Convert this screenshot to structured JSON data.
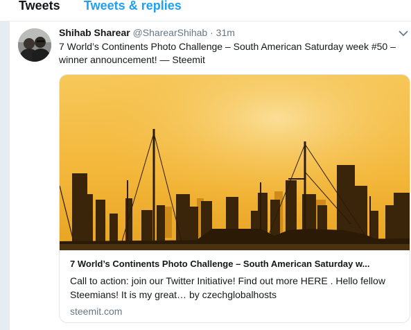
{
  "tabs": [
    {
      "label": "Tweets"
    },
    {
      "label": "Tweets & replies"
    }
  ],
  "tweet": {
    "author_name": "Shihab Sharear",
    "author_handle": "@SharearShihab",
    "separator": "·",
    "time": "31m",
    "text": "7 World’s Continents Photo Challenge – South American Saturday week #50 – winner announcement! — Steemit",
    "card": {
      "title": "7 World’s Continents Photo Challenge – South American Saturday w...",
      "description": "Call to action: join our Twitter Initiative! Find out more HERE . Hello fellow Steemians! It is my great… by czechglobalhosts",
      "domain": "steemit.com"
    }
  },
  "icons": {
    "avatar": "profile-photo",
    "menu": "chevron-down-icon"
  },
  "colors": {
    "accent": "#1da1f2",
    "secondary_text": "#657786",
    "image_sky": "#f3b73a"
  }
}
